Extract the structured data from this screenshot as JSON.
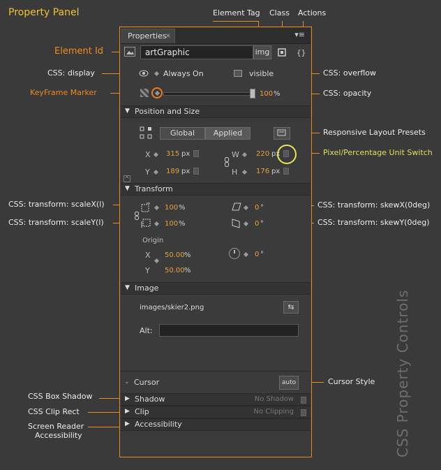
{
  "page_title": "Property Panel",
  "side_title": "CSS Property Controls",
  "annotations": {
    "element_tag": "Element Tag",
    "class": "Class",
    "actions": "Actions",
    "element_id": "Element Id",
    "css_display": "CSS: display",
    "keyframe_marker": "KeyFrame Marker",
    "css_overflow": "CSS: overflow",
    "css_opacity": "CSS: opacity",
    "responsive_layout_presets": "Responsive Layout Presets",
    "pixel_percentage_unit_switch": "Pixel/Percentage Unit Switch",
    "css_scalex": "CSS: transform: scaleX(l)",
    "css_scaley": "CSS: transform: scaleY(l)",
    "css_skewx": "CSS: transform: skewX(0deg)",
    "css_skewy": "CSS: transform: skewY(0deg)",
    "cursor_style": "Cursor Style",
    "css_box_shadow": "CSS Box Shadow",
    "css_clip_rect": "CSS Clip Rect",
    "screen_reader_accessibility_1": "Screen Reader",
    "screen_reader_accessibility_2": "Accessibility"
  },
  "panel": {
    "tab_label": "Properties",
    "tab_close": "×",
    "panel_menu": "▾≡",
    "element_id_value": "artGraphic",
    "element_tag_value": "img",
    "display_value": "Always On",
    "overflow_value": "visible",
    "opacity_value": "100",
    "opacity_unit": "%",
    "sections": {
      "position_size": "Position and Size",
      "transform": "Transform",
      "image": "Image",
      "cursor": "Cursor",
      "shadow": "Shadow",
      "clip": "Clip",
      "accessibility": "Accessibility"
    },
    "segment": {
      "global": "Global",
      "applied": "Applied"
    },
    "position": {
      "x_label": "X",
      "x_value": "315",
      "x_unit": "px",
      "y_label": "Y",
      "y_value": "189",
      "y_unit": "px",
      "w_label": "W",
      "w_value": "220",
      "w_unit": "px",
      "h_label": "H",
      "h_value": "176",
      "h_unit": "px"
    },
    "transform": {
      "scalex_value": "100",
      "scalex_unit": "%",
      "scaley_value": "100",
      "scaley_unit": "%",
      "skewx_value": "0",
      "skewx_unit": "°",
      "skewy_value": "0",
      "skewy_unit": "°",
      "origin_label": "Origin",
      "origin_x_label": "X",
      "origin_x_value": "50.00",
      "origin_x_unit": "%",
      "origin_y_label": "Y",
      "origin_y_value": "50.00",
      "origin_y_unit": "%",
      "rotate_value": "0",
      "rotate_unit": "°"
    },
    "image": {
      "path": "images/skier2.png",
      "alt_label": "Alt:",
      "alt_value": ""
    },
    "cursor_value": "auto",
    "shadow_value": "No Shadow",
    "clip_value": "No Clipping"
  },
  "colors": {
    "accent_orange": "#f08a1e",
    "title_yellow": "#f2c230",
    "value_orange": "#e8a33a",
    "highlight_yellow": "#e8e45a"
  }
}
